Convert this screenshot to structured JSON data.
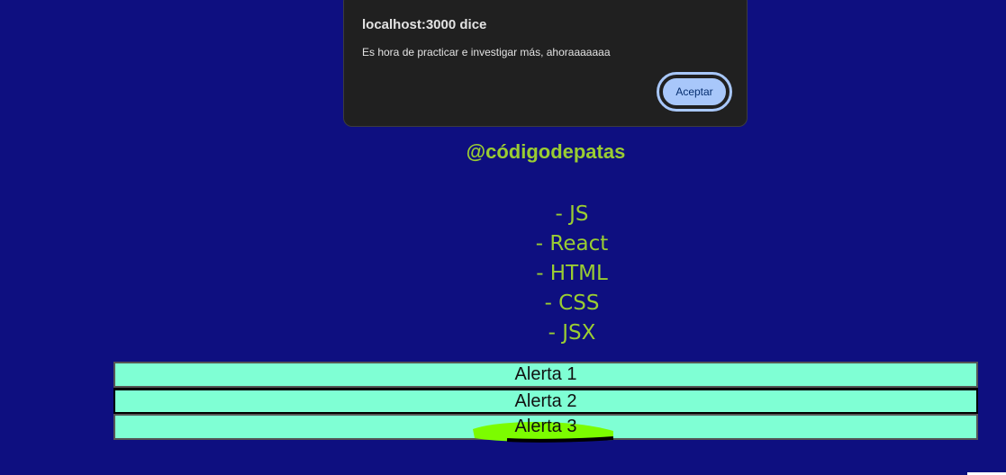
{
  "dialog": {
    "title": "localhost:3000 dice",
    "message": "Es hora de practicar e investigar más, ahoraaaaaaa",
    "ok_label": "Aceptar"
  },
  "page": {
    "handle": "@códigodepatas",
    "tech_items": [
      "- JS",
      "- React",
      "- HTML",
      "- CSS",
      "- JSX"
    ],
    "alert_buttons": [
      "Alerta 1",
      "Alerta 2",
      "Alerta 3"
    ]
  },
  "colors": {
    "background": "#0e0f80",
    "accent_text": "#9acd32",
    "button_bg": "#7fffd4",
    "dialog_bg": "#202020",
    "dialog_button": "#a8c7fa",
    "highlight": "#7cfc00"
  }
}
